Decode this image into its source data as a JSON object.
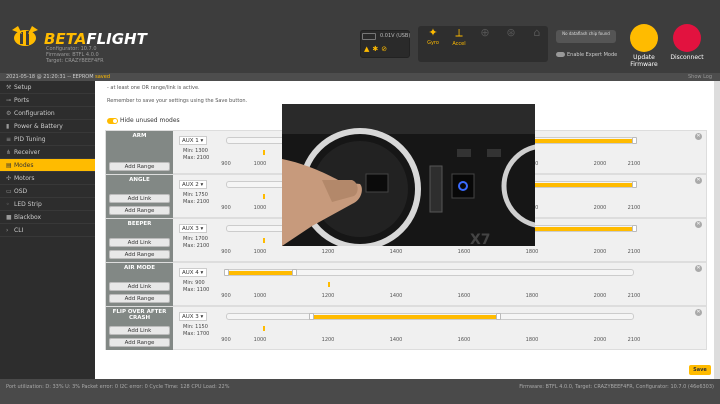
{
  "header": {
    "brand_main": "BETA",
    "brand_rest": "FLIGHT",
    "configurator": "Configurator: 10.7.0",
    "firmware": "Firmware: BTFL 4.0.0",
    "target": "Target: CRAZYBEEF4FR",
    "battery_label": "0.01V (USB)",
    "sensors": [
      {
        "name": "Gyro",
        "icon": "gyro-icon"
      },
      {
        "name": "Accel",
        "icon": "accel-icon"
      },
      {
        "name": "",
        "icon": "mag-icon"
      },
      {
        "name": "",
        "icon": "baro-icon"
      },
      {
        "name": "",
        "icon": "gps-icon"
      }
    ],
    "dataflash": "No dataflash chip found",
    "expert_mode": "Enable Expert Mode",
    "update_label": "Update Firmware",
    "disconnect_label": "Disconnect",
    "accent": "#ffbb00"
  },
  "logbar": {
    "text": "2021-05-18 @ 21:20:31 -- EEPROM",
    "saved": "saved",
    "show_log": "Show Log"
  },
  "sidebar": [
    {
      "label": "Setup",
      "icon": "wrench-icon"
    },
    {
      "label": "Ports",
      "icon": "plug-icon"
    },
    {
      "label": "Configuration",
      "icon": "gear-icon"
    },
    {
      "label": "Power & Battery",
      "icon": "battery-icon"
    },
    {
      "label": "PID Tuning",
      "icon": "sliders-icon"
    },
    {
      "label": "Receiver",
      "icon": "antenna-icon"
    },
    {
      "label": "Modes",
      "icon": "modes-icon",
      "active": true
    },
    {
      "label": "Motors",
      "icon": "motor-icon"
    },
    {
      "label": "OSD",
      "icon": "osd-icon"
    },
    {
      "label": "LED Strip",
      "icon": "led-icon"
    },
    {
      "label": "Blackbox",
      "icon": "blackbox-icon"
    },
    {
      "label": "CLI",
      "icon": "cli-icon"
    }
  ],
  "main": {
    "help1": "- at least one OR range/link is active.",
    "help2": "Remember to save your settings using the Save button.",
    "hide_unused": "Hide unused modes",
    "add_link": "Add Link",
    "add_range": "Add Range",
    "save": "Save",
    "ticks": [
      "900",
      "1000",
      "1200",
      "1400",
      "1600",
      "1800",
      "2000",
      "2100"
    ]
  },
  "modes": [
    {
      "name": "ARM",
      "aux": "AUX 1 ▾",
      "min": "Min: 1300",
      "max": "Max: 2100",
      "range_min": 1300,
      "range_max": 2100,
      "channel": 1010,
      "link": false
    },
    {
      "name": "ANGLE",
      "aux": "AUX 2 ▾",
      "min": "Min: 1750",
      "max": "Max: 2100",
      "range_min": 1750,
      "range_max": 2100,
      "channel": 1010,
      "link": true
    },
    {
      "name": "BEEPER",
      "aux": "AUX 3 ▾",
      "min": "Min: 1700",
      "max": "Max: 2100",
      "range_min": 1700,
      "range_max": 2100,
      "channel": 1010,
      "link": true
    },
    {
      "name": "AIR MODE",
      "aux": "AUX 4 ▾",
      "min": "Min: 900",
      "max": "Max: 1100",
      "range_min": 900,
      "range_max": 1100,
      "channel": 1200,
      "link": true
    },
    {
      "name": "FLIP OVER AFTER CRASH",
      "aux": "AUX 3 ▾",
      "min": "Min: 1150",
      "max": "Max: 1700",
      "range_min": 1150,
      "range_max": 1700,
      "channel": 1010,
      "link": true
    }
  ],
  "statusbar": {
    "left": "Port utilization: D: 33% U: 3%     Packet error: 0     I2C error: 0     Cycle Time: 128     CPU Load: 22%",
    "right": "Firmware: BTFL 4.0.0, Target: CRAZYBEEF4FR, Configurator: 10.7.0 (46e6303)"
  }
}
